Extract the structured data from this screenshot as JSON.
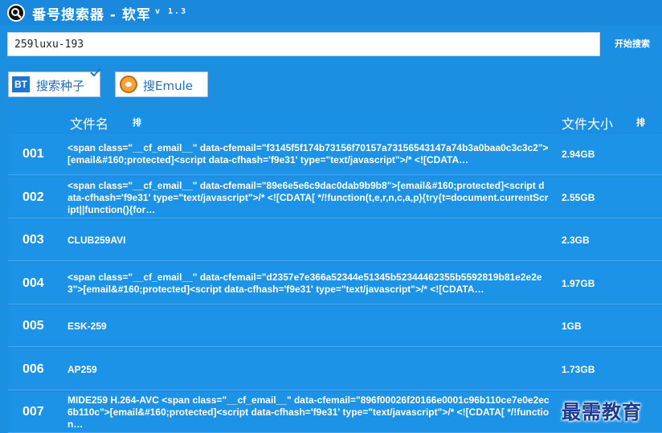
{
  "window": {
    "title": "番号搜索器 - 软军",
    "version": "v 1.3"
  },
  "search": {
    "value": "259luxu-193",
    "button_label": "开始搜索"
  },
  "sources": [
    {
      "label": "搜索种子",
      "icon": "bt-icon"
    },
    {
      "label": "搜Emule",
      "icon": "emule-icon"
    }
  ],
  "table": {
    "headers": {
      "name": "文件名",
      "size": "文件大小",
      "sort": "排"
    },
    "rows": [
      {
        "index": "001",
        "name": "<span class=\"__cf_email__\" data-cfemail=\"f3145f5f174b73156f70157a73156543147a74b3a0baa0c3c3c2\">[email&#160;protected]<script data-cfhash='f9e31' type=\"text/javascript\">/* <![CDATA…",
        "size": "2.94GB"
      },
      {
        "index": "002",
        "name": "<span class=\"__cf_email__\" data-cfemail=\"89e6e5e6c9dac0dab9b9b8\">[email&#160;protected]<script data-cfhash='f9e31' type=\"text/javascript\">/* <![CDATA[ */!function(t,e,r,n,c,a,p){try{t=document.currentScript||function(){for…",
        "size": "2.55GB"
      },
      {
        "index": "003",
        "name": "CLUB259AVI",
        "size": "2.3GB"
      },
      {
        "index": "004",
        "name": "<span class=\"__cf_email__\" data-cfemail=\"d2357e7e366a52344e51345b52344462355b5592819b81e2e2e3\">[email&#160;protected]<script data-cfhash='f9e31' type=\"text/javascript\">/* <![CDATA…",
        "size": "1.97GB"
      },
      {
        "index": "005",
        "name": "ESK-259",
        "size": "1GB"
      },
      {
        "index": "006",
        "name": "AP259",
        "size": "1.73GB"
      },
      {
        "index": "007",
        "name": "MIDE259 H.264-AVC <span class=\"__cf_email__\" data-cfemail=\"896f00026f20166e0001c96b110ce7e0e2ec6b110c\">[email&#160;protected]<script data-cfhash='f9e31' type=\"text/javascript\">/* <![CDATA[ */!function…",
        "size": ""
      }
    ]
  },
  "watermark": "最需教育",
  "colors": {
    "accent": "#1d8fe0",
    "row": "#1d93e8",
    "watermark": "#1e3c8f"
  }
}
